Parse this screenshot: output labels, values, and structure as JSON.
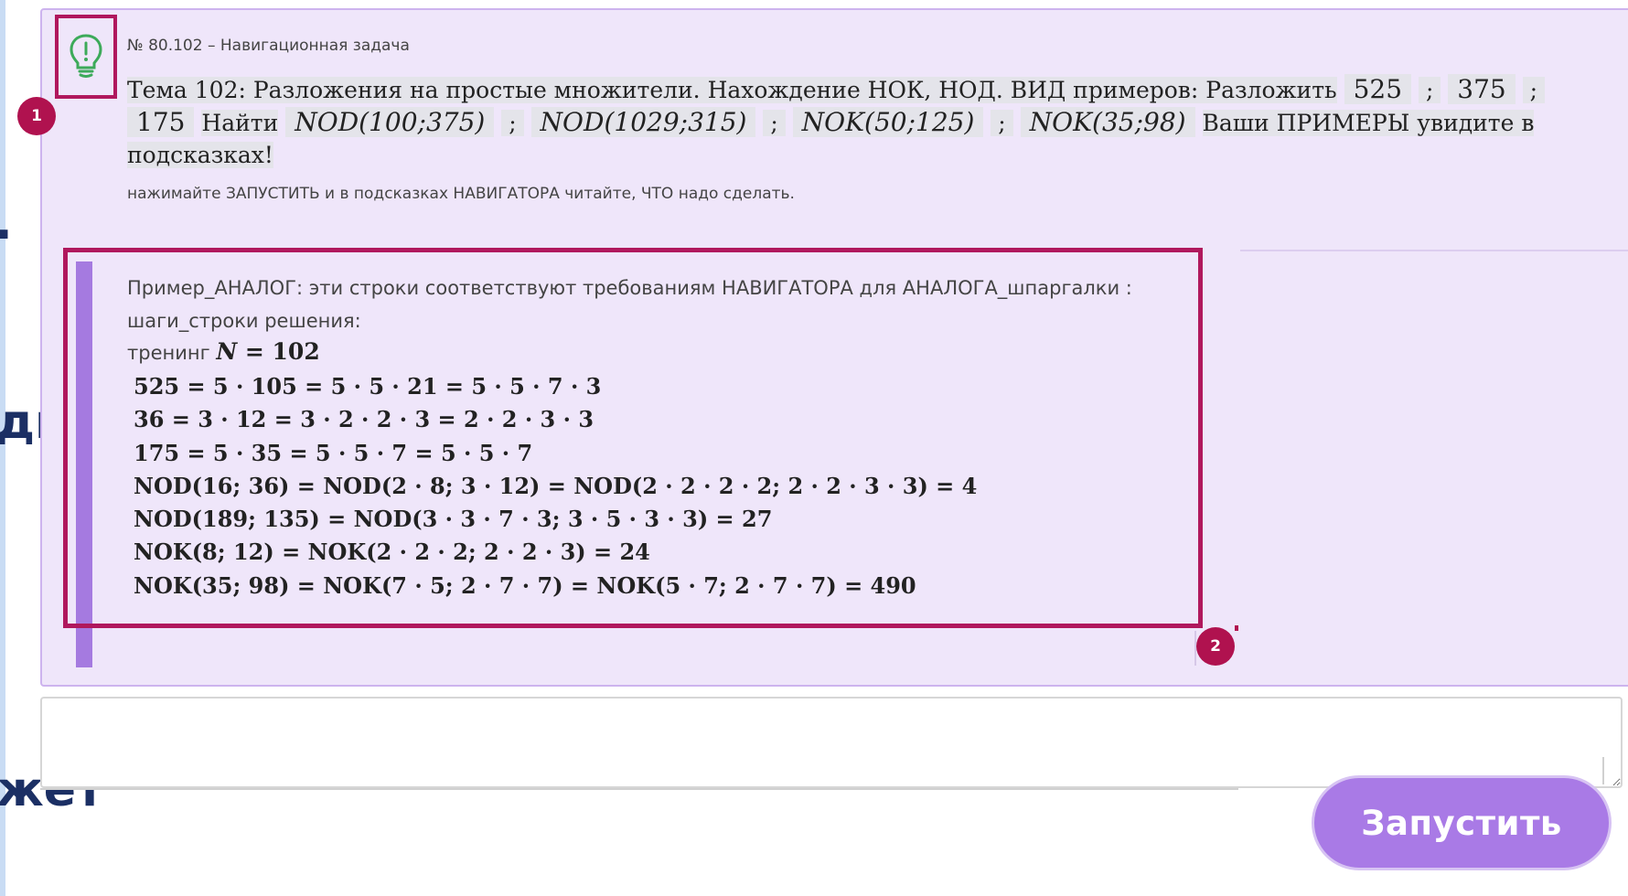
{
  "background_fragments": {
    "line2": "ди",
    "line3": "жет"
  },
  "task": {
    "number_title": "№ 80.102 – Навигационная задача",
    "topic": {
      "intro": "Тема 102: Разложения на простые множители. Нахождение НОК, НОД. ВИД примеров: Разложить",
      "n1": "525",
      "n2": "375",
      "n3": "175",
      "find": "Найти",
      "f1": "NOD(100;375)",
      "f2": "NOD(1029;315)",
      "f3": "NOK(50;125)",
      "f4": "NOK(35;98)",
      "outro": "Ваши ПРИМЕРЫ увидите в подсказках!"
    },
    "instruction": "нажимайте ЗАПУСТИТЬ и в подсказках НАВИГАТОРА читайте, ЧТО надо сделать."
  },
  "example": {
    "intro": "Пример_АНАЛОГ: эти строки соответствуют требованиям НАВИГАТОРА для АНАЛОГА_шпаргалки :",
    "steps_caption": "шаги_строки решения:",
    "training_label": "тренинг",
    "training_var": "N",
    "training_value": " = 102",
    "steps": [
      "525 = 5 · 105 = 5 · 5 · 21 = 5 · 5 · 7 · 3",
      "36 = 3 · 12 = 3 · 2 · 2 · 3 = 2 · 2 · 3 · 3",
      "175 = 5 · 35 = 5 · 5 · 7 = 5 · 5 · 7",
      "NOD(16; 36) = NOD(2 · 8; 3 · 12) = NOD(2 · 2 · 2 · 2; 2 · 2 · 3 · 3) = 4",
      "NOD(189; 135) = NOD(3 · 3 · 7 · 3; 3 · 5 · 3 · 3) = 27",
      "NOK(8; 12) = NOK(2 · 2 · 2; 2 · 2 · 3) = 24",
      "NOK(35; 98) = NOK(7 · 5; 2 · 7 · 7) = NOK(5 · 7; 2 · 7 · 7) = 490"
    ]
  },
  "markers": {
    "m1": "1",
    "m2": "2"
  },
  "input": {
    "placeholder": ""
  },
  "run_button": {
    "label": "Запустить"
  },
  "colors": {
    "card_background": "#efe6fa",
    "accent_purple": "#a97ae6",
    "annotation_magenta": "#b0185d",
    "hint_icon_green": "#3daa5a"
  },
  "icons": {
    "hint": "lightbulb-icon"
  }
}
